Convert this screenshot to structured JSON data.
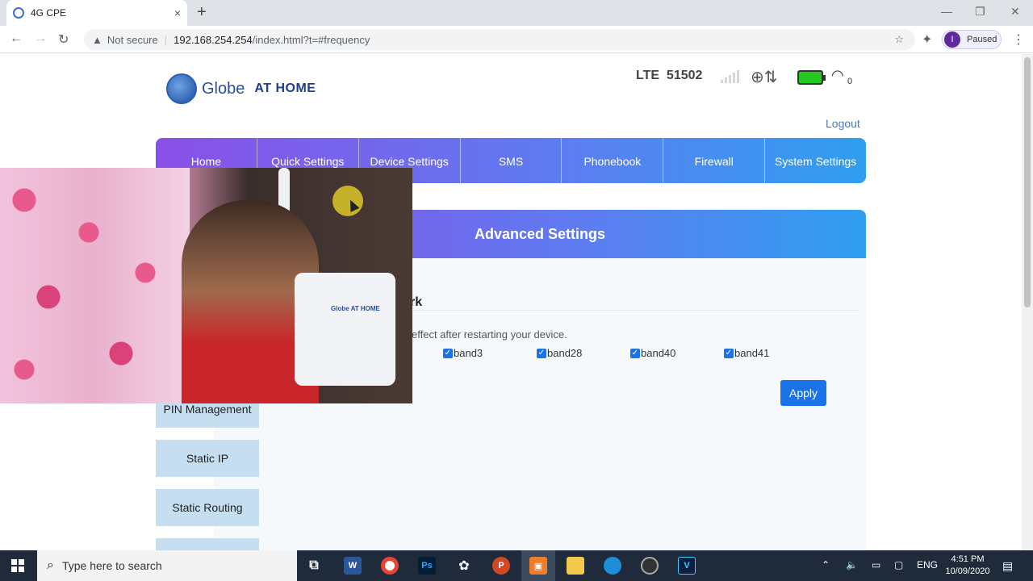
{
  "browser": {
    "tab_title": "4G CPE",
    "tab_close": "×",
    "new_tab": "+",
    "window_controls": [
      "—",
      "❐",
      "✕"
    ],
    "not_secure": "Not secure",
    "url_host": "192.168.254.254",
    "url_path": "/index.html?t=#frequency",
    "profile_initial": "I",
    "profile_status": "Paused"
  },
  "header": {
    "logo_globe_text": "Globe",
    "logo_home_text": "AT HOME",
    "network": "LTE",
    "network_code": "51502",
    "wifi_clients": "0",
    "logout": "Logout"
  },
  "nav": {
    "items": [
      "Home",
      "Quick Settings",
      "Device Settings",
      "SMS",
      "Phonebook",
      "Firewall",
      "System Settings"
    ]
  },
  "panel": {
    "title": "Advanced Settings",
    "section_title_fragment": "rk",
    "note_fragment": "effect after restarting your device.",
    "bands": [
      {
        "label": "band3",
        "checked": true
      },
      {
        "label": "band28",
        "checked": true
      },
      {
        "label": "band40",
        "checked": true
      },
      {
        "label": "band41",
        "checked": true
      }
    ],
    "apply": "Apply"
  },
  "sidebar": {
    "items": [
      "PIN Management",
      "Static IP",
      "Static Routing"
    ]
  },
  "webcam": {
    "router_label": "Globe AT HOME"
  },
  "taskbar": {
    "search_placeholder": "Type here to search",
    "apps": [
      "W",
      "Ps",
      "P",
      "V"
    ],
    "language": "ENG",
    "time": "4:51 PM",
    "date": "10/09/2020"
  },
  "colors": {
    "nav_gradient_start": "#8a4fe8",
    "nav_gradient_end": "#2f9ff0",
    "apply_button": "#1a73e8",
    "sidebar_button": "#c5dff0",
    "battery": "#24c81e"
  }
}
